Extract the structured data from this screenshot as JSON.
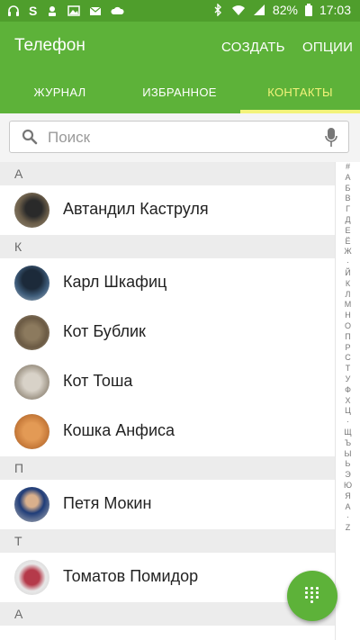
{
  "status_bar": {
    "battery": "82%",
    "time": "17:03",
    "left_icons": [
      "headset-icon",
      "s-app-icon",
      "notification-icon",
      "gallery-icon",
      "mail-icon",
      "cloud-icon"
    ],
    "right_icons": [
      "bluetooth-icon",
      "wifi-icon",
      "signal-icon",
      "battery-icon"
    ]
  },
  "app_bar": {
    "title": "Телефон",
    "create_label": "СОЗДАТЬ",
    "options_label": "ОПЦИИ"
  },
  "tabs": [
    {
      "label": "ЖУРНАЛ",
      "active": false
    },
    {
      "label": "ИЗБРАННОЕ",
      "active": false
    },
    {
      "label": "КОНТАКТЫ",
      "active": true
    }
  ],
  "search": {
    "placeholder": "Поиск",
    "value": ""
  },
  "sections": [
    {
      "letter": "А",
      "contacts": [
        "Автандил Каструля"
      ]
    },
    {
      "letter": "К",
      "contacts": [
        "Карл Шкафиц",
        "Кот Бублик",
        "Кот Тоша",
        "Кошка Анфиса"
      ]
    },
    {
      "letter": "П",
      "contacts": [
        "Петя Мокин"
      ]
    },
    {
      "letter": "Т",
      "contacts": [
        "Томатов Помидор"
      ]
    },
    {
      "letter": "A",
      "contacts": []
    }
  ],
  "index_letters": [
    "#",
    "А",
    "Б",
    "В",
    "Г",
    "Д",
    "Е",
    "Ё",
    "Ж",
    "·",
    "Й",
    "К",
    "Л",
    "М",
    "Н",
    "О",
    "П",
    "Р",
    "С",
    "Т",
    "У",
    "Ф",
    "Х",
    "Ц",
    "·",
    "Щ",
    "Ъ",
    "Ы",
    "Ь",
    "Э",
    "Ю",
    "Я",
    "A",
    "·",
    "Z"
  ],
  "colors": {
    "primary": "#5db239",
    "status": "#4f9e2c",
    "tab_accent": "#f3f37a"
  }
}
